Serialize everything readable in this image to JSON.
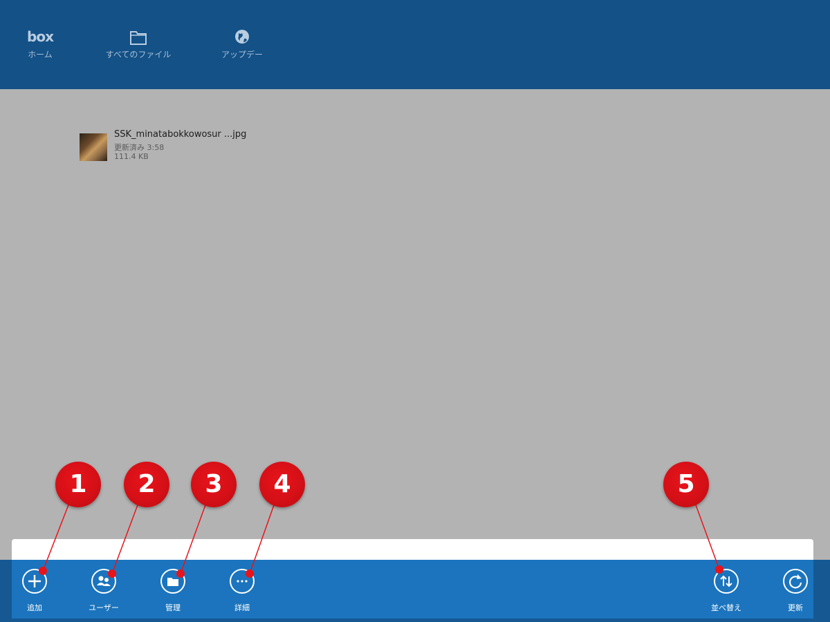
{
  "topbar": {
    "logo_text": "box",
    "nav": [
      {
        "label": "ホーム",
        "icon": "box-logo"
      },
      {
        "label": "すべてのファイル",
        "icon": "folder-icon"
      },
      {
        "label": "アップデー",
        "icon": "globe-icon"
      }
    ]
  },
  "file": {
    "name": "SSK_minatabokkowosur ...jpg",
    "modified": "更新済み 3:58",
    "size": "111.4 KB"
  },
  "appbar": {
    "commands": [
      {
        "label": "追加",
        "icon": "plus-icon"
      },
      {
        "label": "ユーザー",
        "icon": "users-icon"
      },
      {
        "label": "管理",
        "icon": "folder-manage-icon"
      },
      {
        "label": "詳細",
        "icon": "more-icon"
      },
      {
        "label": "並べ替え",
        "icon": "sort-icon"
      },
      {
        "label": "更新",
        "icon": "refresh-icon"
      }
    ]
  },
  "callouts": [
    "1",
    "2",
    "3",
    "4",
    "5"
  ],
  "colors": {
    "topbar": "#135187",
    "appbar": "#1b74bd",
    "background": "#b3b3b3",
    "callout": "#e8141b"
  }
}
